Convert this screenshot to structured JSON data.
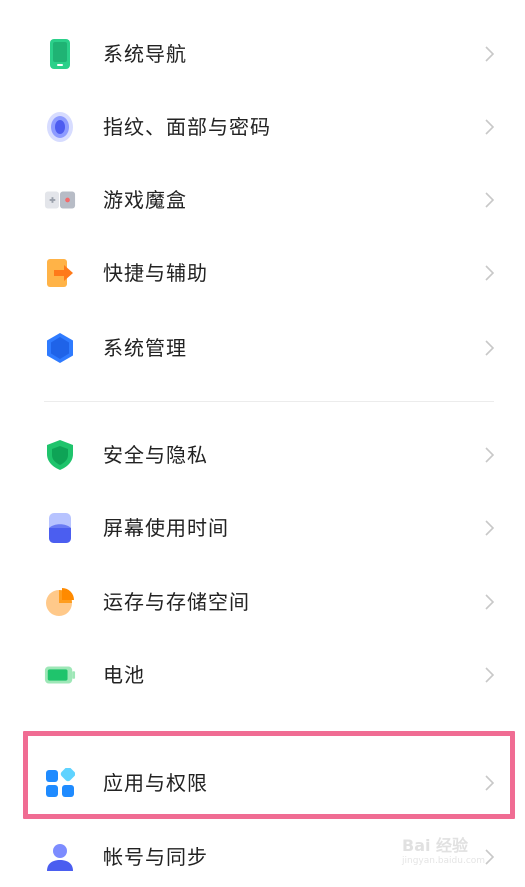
{
  "settings": {
    "items": [
      {
        "label": "系统导航",
        "icon": "phone-nav-icon"
      },
      {
        "label": "指纹、面部与密码",
        "icon": "fingerprint-icon"
      },
      {
        "label": "游戏魔盒",
        "icon": "game-box-icon"
      },
      {
        "label": "快捷与辅助",
        "icon": "shortcut-icon"
      },
      {
        "label": "系统管理",
        "icon": "system-manage-icon"
      },
      {
        "label": "安全与隐私",
        "icon": "shield-icon"
      },
      {
        "label": "屏幕使用时间",
        "icon": "screen-time-icon"
      },
      {
        "label": "运存与存储空间",
        "icon": "storage-pie-icon"
      },
      {
        "label": "电池",
        "icon": "battery-icon"
      },
      {
        "label": "应用与权限",
        "icon": "apps-icon"
      },
      {
        "label": "帐号与同步",
        "icon": "account-icon"
      }
    ]
  },
  "watermark": {
    "logo": "Bai 经验",
    "url": "jingyan.baidu.com"
  },
  "colors": {
    "highlight": "#f06c93",
    "chevron": "#c8c8c8",
    "text": "#222222"
  }
}
